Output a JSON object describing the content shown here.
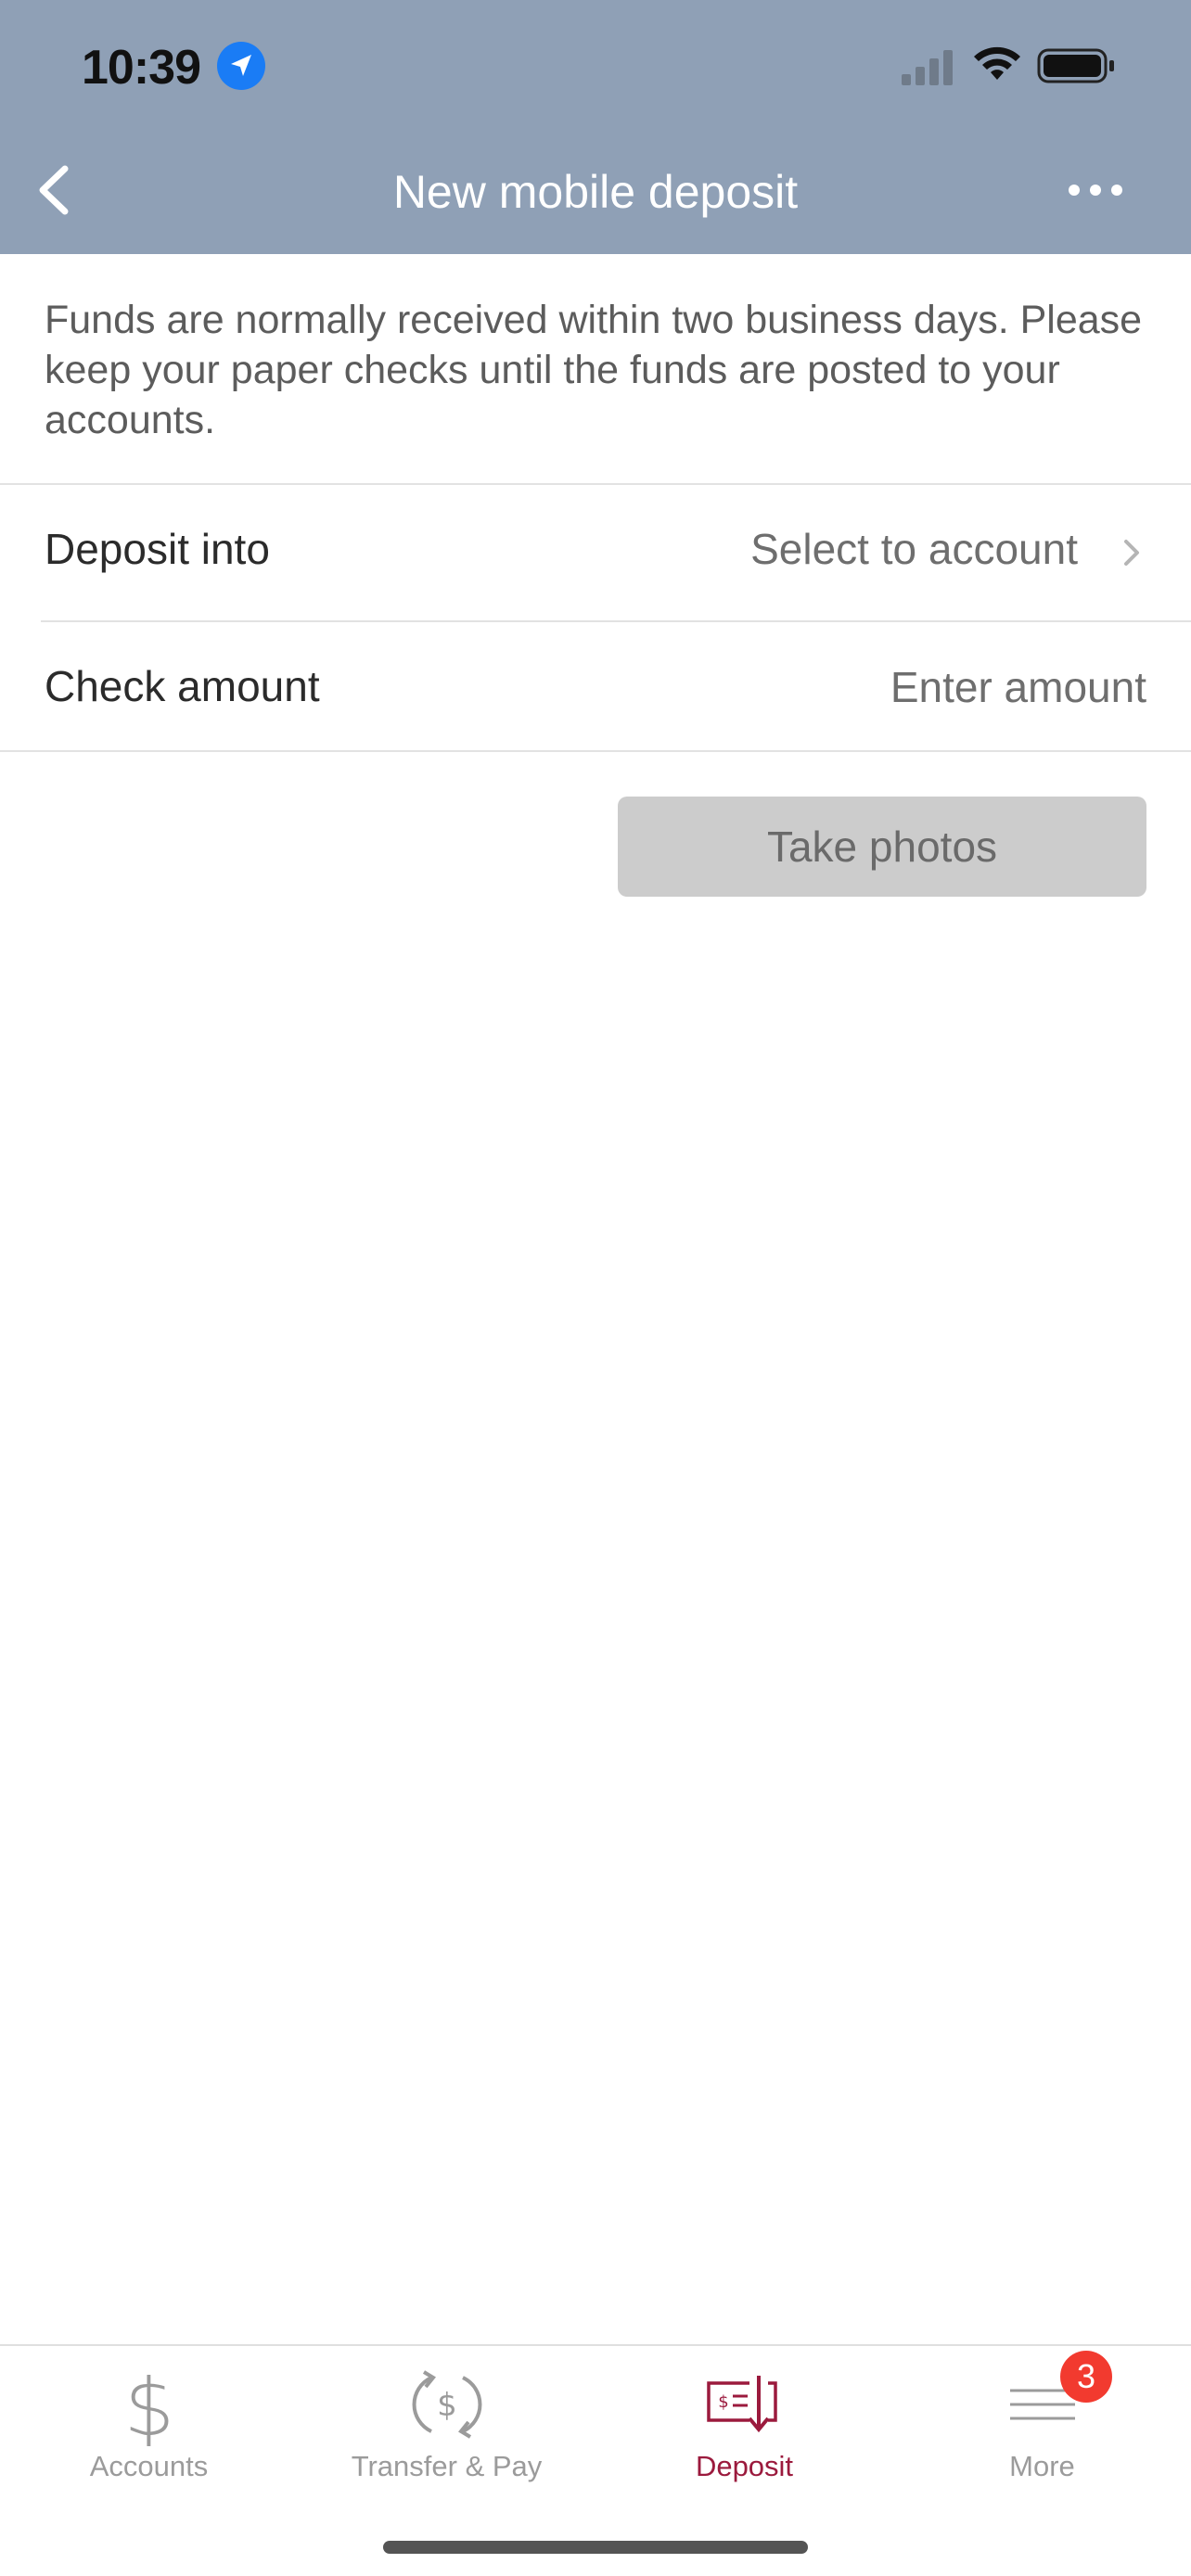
{
  "status_bar": {
    "time": "10:39",
    "location_icon": "location-arrow-icon",
    "signal_icon": "cellular-signal-icon",
    "wifi_icon": "wifi-icon",
    "battery_icon": "battery-icon"
  },
  "nav": {
    "title": "New mobile deposit",
    "back_icon": "chevron-left-icon",
    "more_icon": "ellipsis-icon"
  },
  "info": {
    "text": "Funds are normally received within two business days. Please keep your paper checks until the funds are posted to your accounts."
  },
  "form": {
    "deposit_into_label": "Deposit into",
    "deposit_into_value": "Select to account",
    "check_amount_label": "Check amount",
    "check_amount_placeholder": "Enter amount",
    "take_photos_label": "Take photos"
  },
  "tabbar": {
    "tabs": [
      {
        "label": "Accounts",
        "icon": "dollar-icon"
      },
      {
        "label": "Transfer & Pay",
        "icon": "transfer-dollar-icon"
      },
      {
        "label": "Deposit",
        "icon": "check-deposit-icon"
      },
      {
        "label": "More",
        "icon": "menu-icon"
      }
    ],
    "more_badge": "3",
    "active_tab": "Deposit"
  },
  "colors": {
    "header_bg": "#8fa0b6",
    "active_tab": "#9b1a3d",
    "inactive_tab": "#9b9b9b",
    "badge": "#f23a2f",
    "disabled_button": "#cccccc"
  }
}
